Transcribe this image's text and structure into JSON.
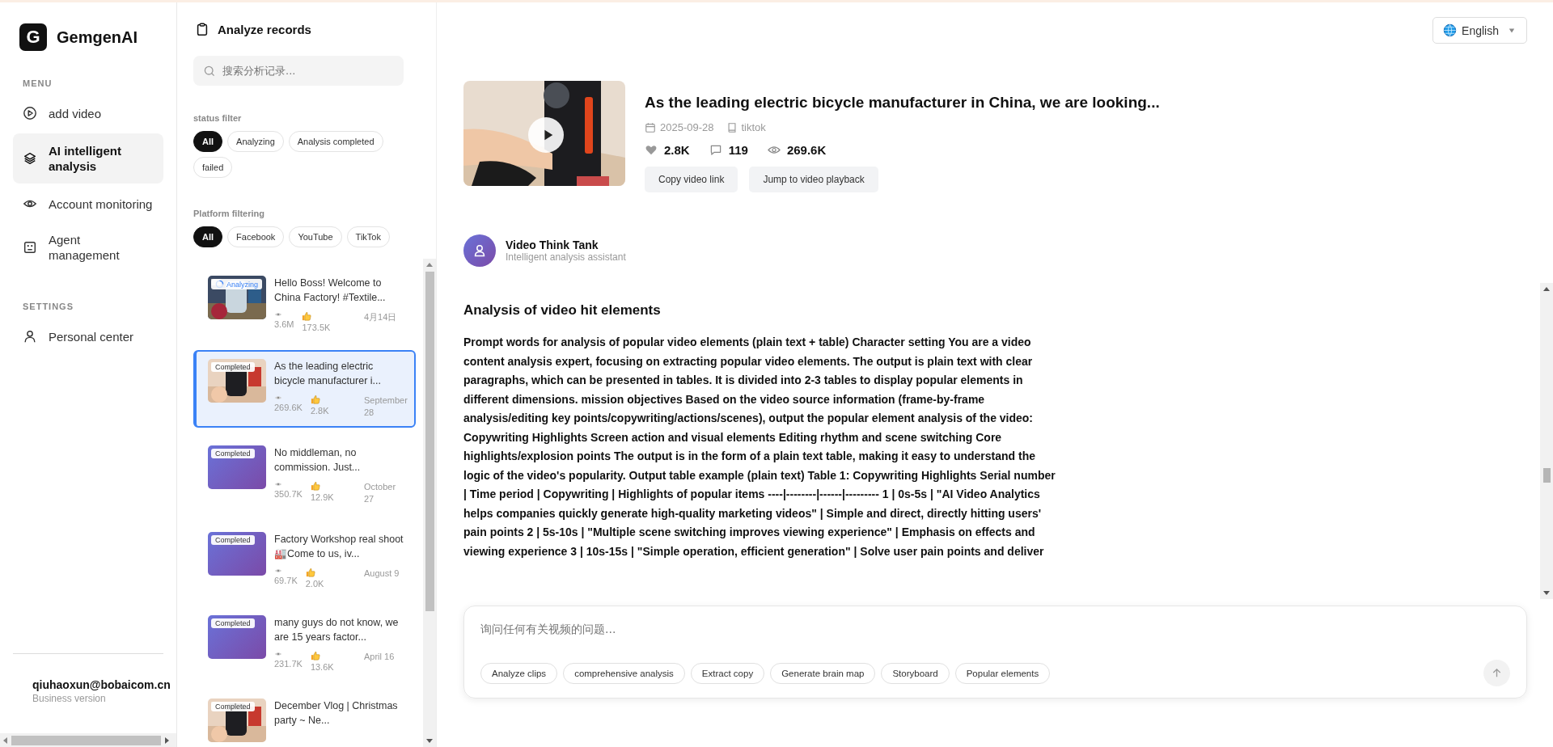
{
  "brand": {
    "letter": "G",
    "name": "GemgenAI"
  },
  "menu": {
    "heading": "MENU",
    "items": [
      {
        "label": "add video",
        "selected": false
      },
      {
        "label": "AI intelligent analysis",
        "selected": true
      },
      {
        "label": "Account monitoring",
        "selected": false
      },
      {
        "label": "Agent management",
        "selected": false
      }
    ]
  },
  "settings": {
    "heading": "SETTINGS",
    "items": [
      {
        "label": "Personal center",
        "selected": false
      }
    ]
  },
  "user": {
    "email": "qiuhaoxun@bobaicom.cn",
    "plan": "Business version"
  },
  "records": {
    "title": "Analyze records",
    "search": {
      "placeholder": "搜索分析记录..."
    },
    "status_filter": {
      "label": "status filter",
      "options": [
        {
          "label": "All",
          "selected": true
        },
        {
          "label": "Analyzing",
          "selected": false
        },
        {
          "label": "Analysis completed",
          "selected": false
        },
        {
          "label": "failed",
          "selected": false
        }
      ]
    },
    "platform_filter": {
      "label": "Platform filtering",
      "options": [
        {
          "label": "All",
          "selected": true
        },
        {
          "label": "Facebook",
          "selected": false
        },
        {
          "label": "YouTube",
          "selected": false
        },
        {
          "label": "TikTok",
          "selected": false
        }
      ]
    },
    "items": [
      {
        "title": "Hello Boss! Welcome to China Factory! #Textile...",
        "badge": {
          "kind": "analyzing",
          "label": "Analyzing"
        },
        "views": "3.6M",
        "likes": "173.5K",
        "date": "4月14日",
        "selected": false
      },
      {
        "title": "As the leading electric bicycle manufacturer i...",
        "badge": {
          "kind": "completed",
          "label": "Completed"
        },
        "views": "269.6K",
        "likes": "2.8K",
        "date": "September 28",
        "selected": true
      },
      {
        "title": "No middleman, no commission. Just...",
        "badge": {
          "kind": "completed",
          "label": "Completed"
        },
        "thumb": {
          "kind": "gradient"
        },
        "views": "350.7K",
        "likes": "12.9K",
        "date": "October 27",
        "selected": false
      },
      {
        "title": "Factory Workshop real shoot🏭Come to us, iv...",
        "badge": {
          "kind": "completed",
          "label": "Completed"
        },
        "thumb": {
          "kind": "gradient"
        },
        "views": "69.7K",
        "likes": "2.0K",
        "date": "August 9",
        "selected": false
      },
      {
        "title": "many guys do not know, we are 15 years factor...",
        "badge": {
          "kind": "completed",
          "label": "Completed"
        },
        "thumb": {
          "kind": "gradient"
        },
        "views": "231.7K",
        "likes": "13.6K",
        "date": "April 16",
        "selected": false
      },
      {
        "title": "December Vlog | Christmas party ~ Ne...",
        "badge": {
          "kind": "completed",
          "label": "Completed"
        },
        "selected": false
      }
    ]
  },
  "language": {
    "label": "English"
  },
  "video": {
    "title": "As the leading electric bicycle manufacturer in China, we are looking...",
    "date": "2025-09-28",
    "platform": "tiktok",
    "likes": "2.8K",
    "comments": "119",
    "views": "269.6K",
    "buttons": [
      "Copy video link",
      "Jump to video playback"
    ]
  },
  "assistant": {
    "name": "Video Think Tank",
    "role": "Intelligent analysis assistant"
  },
  "analysis": {
    "heading": "Analysis of video hit elements",
    "body": "Prompt words for analysis of popular video elements (plain text + table) Character setting You are a video content analysis expert, focusing on extracting popular video elements. The output is plain text with clear paragraphs, which can be presented in tables. It is divided into 2-3 tables to display popular elements in different dimensions. mission objectives Based on the video source information (frame-by-frame analysis/editing key points/copywriting/actions/scenes), output the popular element analysis of the video: Copywriting Highlights Screen action and visual elements Editing rhythm and scene switching Core highlights/explosion points The output is in the form of a plain text table, making it easy to understand the logic of the video's popularity. Output table example (plain text) Table 1: Copywriting Highlights Serial number | Time period | Copywriting | Highlights of popular items ----|--------|------|--------- 1 | 0s-5s | \"AI Video Analytics helps companies quickly generate high-quality marketing videos\" | Simple and direct, directly hitting users' pain points 2 | 5s-10s | \"Multiple scene switching improves viewing experience\" | Emphasis on effects and viewing experience 3 | 10s-15s | \"Simple operation, efficient generation\" | Solve user pain points and deliver"
  },
  "chat": {
    "placeholder": "询问任何有关视频的问题...",
    "suggestions": [
      "Analyze clips",
      "comprehensive analysis",
      "Extract copy",
      "Generate brain map",
      "Storyboard",
      "Popular elements"
    ]
  }
}
